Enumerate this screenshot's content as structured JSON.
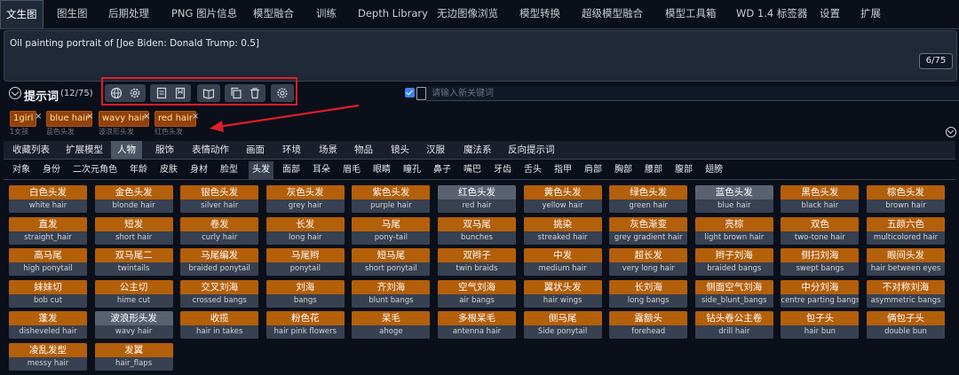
{
  "top_tabs": [
    "文生图",
    "图生图",
    "后期处理",
    "PNG 图片信息",
    "模型融合",
    "训练",
    "Depth Library",
    "无边图像浏览",
    "模型转换",
    "超级模型融合",
    "模型工具箱",
    "WD 1.4 标签器",
    "设置",
    "扩展"
  ],
  "prompt": {
    "text": "Oil painting portrait of [Joe Biden: Donald Trump: 0.5]",
    "token_count": "6/75"
  },
  "prompt_tags": {
    "title": "提示词",
    "count": "(12/75)"
  },
  "keyword_input": {
    "placeholder": "请输入新关键词"
  },
  "chips": [
    {
      "label": "1girl",
      "sub": "1女孩"
    },
    {
      "label": "blue hair",
      "sub": "蓝色头发"
    },
    {
      "label": "wavy hair",
      "sub": "波浪形头发"
    },
    {
      "label": "red hair",
      "sub": "红色头发"
    }
  ],
  "chip_remove_glyph": "×",
  "category_tabs": [
    "收藏列表",
    "扩展模型",
    "人物",
    "服饰",
    "表情动作",
    "画面",
    "环境",
    "场景",
    "物品",
    "镜头",
    "汉服",
    "魔法系",
    "反向提示词"
  ],
  "sub_tabs": [
    "对象",
    "身份",
    "二次元角色",
    "年龄",
    "皮肤",
    "身材",
    "脸型",
    "头发",
    "面部",
    "耳朵",
    "眉毛",
    "眼睛",
    "瞳孔",
    "鼻子",
    "嘴巴",
    "牙齿",
    "舌头",
    "指甲",
    "肩部",
    "胸部",
    "腰部",
    "腹部",
    "翅膀"
  ],
  "tags": [
    {
      "cn": "白色头发",
      "en": "white hair",
      "sel": false
    },
    {
      "cn": "金色头发",
      "en": "blonde hair",
      "sel": false
    },
    {
      "cn": "银色头发",
      "en": "silver hair",
      "sel": false
    },
    {
      "cn": "灰色头发",
      "en": "grey hair",
      "sel": false
    },
    {
      "cn": "紫色头发",
      "en": "purple hair",
      "sel": false
    },
    {
      "cn": "红色头发",
      "en": "red hair",
      "sel": true
    },
    {
      "cn": "黄色头发",
      "en": "yellow hair",
      "sel": false
    },
    {
      "cn": "绿色头发",
      "en": "green hair",
      "sel": false
    },
    {
      "cn": "蓝色头发",
      "en": "blue hair",
      "sel": true
    },
    {
      "cn": "黑色头发",
      "en": "black hair",
      "sel": false
    },
    {
      "cn": "棕色头发",
      "en": "brown hair",
      "sel": false
    },
    {
      "cn": "直发",
      "en": "straight_hair",
      "sel": false
    },
    {
      "cn": "短发",
      "en": "short hair",
      "sel": false
    },
    {
      "cn": "卷发",
      "en": "curly hair",
      "sel": false
    },
    {
      "cn": "长发",
      "en": "long hair",
      "sel": false
    },
    {
      "cn": "马尾",
      "en": "pony-tail",
      "sel": false
    },
    {
      "cn": "双马尾",
      "en": "bunches",
      "sel": false
    },
    {
      "cn": "挑染",
      "en": "streaked hair",
      "sel": false
    },
    {
      "cn": "灰色渐变",
      "en": "grey gradient hair",
      "sel": false
    },
    {
      "cn": "亮棕",
      "en": "light brown hair",
      "sel": false
    },
    {
      "cn": "双色",
      "en": "two-tone hair",
      "sel": false
    },
    {
      "cn": "五颜六色",
      "en": "multicolored hair",
      "sel": false
    },
    {
      "cn": "高马尾",
      "en": "high ponytail",
      "sel": false
    },
    {
      "cn": "双马尾二",
      "en": "twintails",
      "sel": false
    },
    {
      "cn": "马尾编发",
      "en": "braided ponytail",
      "sel": false
    },
    {
      "cn": "马尾辫",
      "en": "ponytail",
      "sel": false
    },
    {
      "cn": "短马尾",
      "en": "short ponytail",
      "sel": false
    },
    {
      "cn": "双辫子",
      "en": "twin braids",
      "sel": false
    },
    {
      "cn": "中发",
      "en": "medium hair",
      "sel": false
    },
    {
      "cn": "超长发",
      "en": "very long hair",
      "sel": false
    },
    {
      "cn": "辫子刘海",
      "en": "braided bangs",
      "sel": false
    },
    {
      "cn": "侧扫刘海",
      "en": "swept bangs",
      "sel": false
    },
    {
      "cn": "眼间头发",
      "en": "hair between eyes",
      "sel": false
    },
    {
      "cn": "妹妹切",
      "en": "bob cut",
      "sel": false
    },
    {
      "cn": "公主切",
      "en": "hime cut",
      "sel": false
    },
    {
      "cn": "交叉刘海",
      "en": "crossed bangs",
      "sel": false
    },
    {
      "cn": "刘海",
      "en": "bangs",
      "sel": false
    },
    {
      "cn": "齐刘海",
      "en": "blunt bangs",
      "sel": false
    },
    {
      "cn": "空气刘海",
      "en": "air bangs",
      "sel": false
    },
    {
      "cn": "翼状头发",
      "en": "hair wings",
      "sel": false
    },
    {
      "cn": "长刘海",
      "en": "long bangs",
      "sel": false
    },
    {
      "cn": "侧面空气刘海",
      "en": "side_blunt_bangs",
      "sel": false
    },
    {
      "cn": "中分刘海",
      "en": "centre parting bangs",
      "sel": false
    },
    {
      "cn": "不对称刘海",
      "en": "asymmetric bangs",
      "sel": false
    },
    {
      "cn": "蓬发",
      "en": "disheveled hair",
      "sel": false
    },
    {
      "cn": "波浪形头发",
      "en": "wavy hair",
      "sel": true
    },
    {
      "cn": "收揽",
      "en": "hair in takes",
      "sel": false
    },
    {
      "cn": "粉色花",
      "en": "hair pink flowers",
      "sel": false
    },
    {
      "cn": "呆毛",
      "en": "ahoge",
      "sel": false
    },
    {
      "cn": "多根呆毛",
      "en": "antenna hair",
      "sel": false
    },
    {
      "cn": "侧马尾",
      "en": "Side ponytail",
      "sel": false
    },
    {
      "cn": "露额头",
      "en": "forehead",
      "sel": false
    },
    {
      "cn": "钻头卷公主卷",
      "en": "drill hair",
      "sel": false
    },
    {
      "cn": "包子头",
      "en": "hair bun",
      "sel": false
    },
    {
      "cn": "俩包子头",
      "en": "double bun",
      "sel": false
    },
    {
      "cn": "凌乱发型",
      "en": "messy hair",
      "sel": false
    },
    {
      "cn": "发翼",
      "en": "hair_flaps",
      "sel": false
    }
  ],
  "colors": {
    "accent_orange": "#b45f0a",
    "selected_grey": "#5a6272",
    "highlight_red": "#e11d2a",
    "checkbox_blue": "#3b82f6"
  }
}
